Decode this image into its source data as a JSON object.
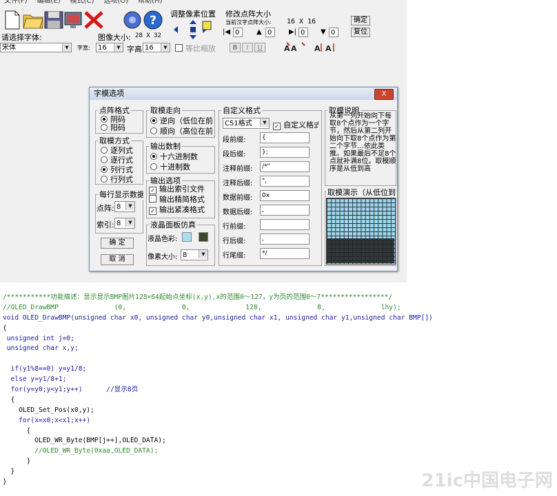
{
  "menu": [
    "文件(F)",
    "编辑(E)",
    "模式(C)",
    "选项(O)",
    "帮助(H)"
  ],
  "main": {
    "font_label": "请选择字体:",
    "font_value": "宋体",
    "size_small_label": "字宽:",
    "width_value": "16",
    "image_size_label": "图像大小:",
    "image_size_value": "28 X 32",
    "height_label": "字高",
    "height_value": "16",
    "proportional_label": "等比缩放",
    "adjust_pos_label": "调整像素位置",
    "modify_grid_label": "修改点阵大小",
    "current_grid_label": "当前汉字点阵大小:",
    "current_grid_value": "16 X 16",
    "confirm_btn": "确定",
    "reset_btn": "复位",
    "spin_values": [
      "0",
      "0",
      "0",
      "0"
    ],
    "fmt_bold": "B",
    "fmt_italic": "I",
    "fmt_underline": "U"
  },
  "dialog": {
    "title": "字模选项",
    "close": "X",
    "dot_format": {
      "title": "点阵格式",
      "options": [
        "阴码",
        "阳码"
      ],
      "selected": 0
    },
    "scan_mode": {
      "title": "取模方式",
      "options": [
        "逐列式",
        "逐行式",
        "列行式",
        "行列式"
      ],
      "selected": 2
    },
    "per_line": {
      "title": "每行显示数据",
      "dot_label": "点阵:",
      "dot_value": "8",
      "index_label": "索引:",
      "index_value": "8"
    },
    "confirm": "确 定",
    "cancel": "取 消",
    "direction": {
      "title": "取模走向",
      "options": [
        "逆向（低位在前）",
        "顺向（高位在前）"
      ],
      "selected": 0
    },
    "number_sys": {
      "title": "输出数制",
      "options": [
        "十六进制数",
        "十进制数"
      ],
      "selected": 0
    },
    "output_opts": {
      "title": "输出选项",
      "items": [
        {
          "label": "输出索引文件",
          "checked": true
        },
        {
          "label": "输出精简格式",
          "checked": false
        },
        {
          "label": "输出紧凑格式",
          "checked": true
        }
      ]
    },
    "lcd": {
      "title": "液晶面板仿真",
      "color_label": "液晶色彩:",
      "pixel_label": "像素大小:",
      "pixel_value": "8",
      "colors": [
        "#a8dcee",
        "#3a4a2a"
      ]
    },
    "custom": {
      "title": "自定义格式",
      "format_value": "C51格式",
      "custom_check_label": "自定义格式",
      "fields": [
        {
          "label": "段前缀:",
          "value": "{"
        },
        {
          "label": "段后缀:",
          "value": "};"
        },
        {
          "label": "注释前缀:",
          "value": "/*\""
        },
        {
          "label": "注释后缀:",
          "value": "\","
        },
        {
          "label": "数据前缀:",
          "value": "0x"
        },
        {
          "label": "数据后缀:",
          "value": ","
        },
        {
          "label": "行前缀:",
          "value": ""
        },
        {
          "label": "行后缀:",
          "value": ","
        },
        {
          "label": "行尾缀:",
          "value": "*/"
        }
      ]
    },
    "explain": {
      "title": "取模说明",
      "text": "从第一列开始向下每取8个点作为一个字节，然后从第二列开始向下取8个点作为第二个字节…依此类推。如果最后不足8个点就补满8位。取模顺序是从低到高"
    },
    "demo_title": "取模演示（从低位到高位）"
  },
  "code_lines": [
    "/***********功能描述：显示显示BMP图片128×64起始点坐标(x,y),x的范围0～127，y为页的范围0～7*****************/",
    "//OLED_DrawBMP              (0,              0,              128,              8,              lhy);",
    "void OLED_DrawBMP(unsigned char x0, unsigned char y0,unsigned char x1, unsigned char y1,unsigned char BMP[])",
    "{",
    " unsigned int j=0;",
    " unsigned char x,y;",
    "",
    "  if(y1%8==0) y=y1/8;",
    "  else y=y1/8+1;",
    "  for(y=y0;y<y1;y++)      //显示8页",
    "  {",
    "    OLED_Set_Pos(x0,y);",
    "    for(x=x0;x<x1;x++)",
    "      {",
    "        OLED_WR_Byte(BMP[j++],OLED_DATA);",
    "        //OLED_WR_Byte(0xaa,OLED_DATA);",
    "      }",
    "  }",
    "}"
  ],
  "watermark": "21ic中国电子网"
}
